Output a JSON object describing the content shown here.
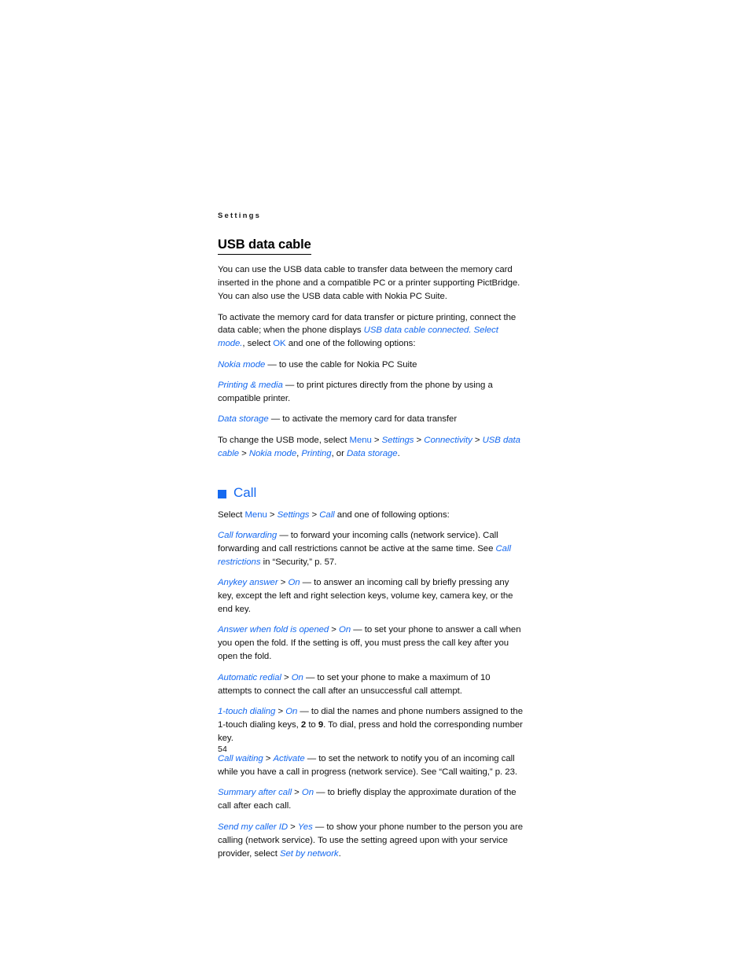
{
  "running_header": "Settings",
  "folio": "54",
  "colors": {
    "accent_blue": "#1569f0",
    "body_text": "#111111"
  },
  "sections": [
    {
      "id": "usb-data-cable",
      "heading": "USB data cable",
      "heading_style": "underlined",
      "paragraphs": [
        {
          "id": "usb-intro",
          "runs": [
            {
              "t": "You can use the USB data cable to transfer data between the memory card inserted in the phone and a compatible PC or a printer supporting PictBridge. You can also use the USB data cable with Nokia PC Suite.",
              "s": "plain"
            }
          ]
        },
        {
          "id": "usb-activate",
          "runs": [
            {
              "t": "To activate the memory card for data transfer or picture printing, connect the data cable; when the phone displays ",
              "s": "plain"
            },
            {
              "t": "USB data cable connected. Select mode.",
              "s": "ui"
            },
            {
              "t": ", select ",
              "s": "plain"
            },
            {
              "t": "OK",
              "s": "key"
            },
            {
              "t": " and one of the following options:",
              "s": "plain"
            }
          ]
        },
        {
          "id": "usb-opt-nokia-mode",
          "runs": [
            {
              "t": "Nokia mode",
              "s": "ui"
            },
            {
              "t": " — to use the cable for Nokia PC Suite",
              "s": "plain"
            }
          ]
        },
        {
          "id": "usb-opt-printing-media",
          "runs": [
            {
              "t": "Printing & media",
              "s": "ui"
            },
            {
              "t": " — to print pictures directly from the phone by using a compatible printer.",
              "s": "plain"
            }
          ]
        },
        {
          "id": "usb-opt-data-storage",
          "runs": [
            {
              "t": "Data storage",
              "s": "ui"
            },
            {
              "t": " — to activate the memory card for data transfer",
              "s": "plain"
            }
          ]
        },
        {
          "id": "usb-change-mode",
          "runs": [
            {
              "t": "To change the USB mode, select ",
              "s": "plain"
            },
            {
              "t": "Menu",
              "s": "key"
            },
            {
              "t": " > ",
              "s": "gt"
            },
            {
              "t": "Settings",
              "s": "ui"
            },
            {
              "t": " > ",
              "s": "gt"
            },
            {
              "t": "Connectivity",
              "s": "ui"
            },
            {
              "t": " > ",
              "s": "gt"
            },
            {
              "t": "USB data cable",
              "s": "ui"
            },
            {
              "t": " > ",
              "s": "gt"
            },
            {
              "t": "Nokia mode",
              "s": "ui"
            },
            {
              "t": ", ",
              "s": "plain"
            },
            {
              "t": "Printing",
              "s": "ui"
            },
            {
              "t": ", or ",
              "s": "plain"
            },
            {
              "t": "Data storage",
              "s": "ui"
            },
            {
              "t": ".",
              "s": "plain"
            }
          ]
        }
      ]
    },
    {
      "id": "call",
      "heading": "Call",
      "heading_style": "chapter",
      "bullet_icon": "blue-square-bullet",
      "paragraphs": [
        {
          "id": "call-intro",
          "runs": [
            {
              "t": "Select ",
              "s": "plain"
            },
            {
              "t": "Menu",
              "s": "key"
            },
            {
              "t": " > ",
              "s": "gt"
            },
            {
              "t": "Settings",
              "s": "ui"
            },
            {
              "t": " > ",
              "s": "gt"
            },
            {
              "t": "Call",
              "s": "ui"
            },
            {
              "t": " and one of following options:",
              "s": "plain"
            }
          ]
        },
        {
          "id": "call-forwarding",
          "runs": [
            {
              "t": "Call forwarding",
              "s": "ui"
            },
            {
              "t": " — to forward your incoming calls (network service). Call forwarding and call restrictions cannot be active at the same time. See ",
              "s": "plain"
            },
            {
              "t": "Call restrictions",
              "s": "ui"
            },
            {
              "t": " in “Security,” p. 57.",
              "s": "plain"
            }
          ]
        },
        {
          "id": "anykey-answer",
          "runs": [
            {
              "t": "Anykey answer",
              "s": "ui"
            },
            {
              "t": " > ",
              "s": "gt"
            },
            {
              "t": "On",
              "s": "ui"
            },
            {
              "t": " — to answer an incoming call by briefly pressing any key, except the left and right selection keys, volume key, camera key, or the end key.",
              "s": "plain"
            }
          ]
        },
        {
          "id": "answer-when-fold-is-opened",
          "runs": [
            {
              "t": "Answer when fold is opened",
              "s": "ui"
            },
            {
              "t": " > ",
              "s": "gt"
            },
            {
              "t": "On",
              "s": "ui"
            },
            {
              "t": " — to set your phone to answer a call when you open the fold. If the setting is off, you must press the call key after you open the fold.",
              "s": "plain"
            }
          ]
        },
        {
          "id": "automatic-redial",
          "runs": [
            {
              "t": "Automatic redial",
              "s": "ui"
            },
            {
              "t": " > ",
              "s": "gt"
            },
            {
              "t": "On",
              "s": "ui"
            },
            {
              "t": " — to set your phone to make a maximum of 10 attempts to connect the call after an unsuccessful call attempt.",
              "s": "plain"
            }
          ]
        },
        {
          "id": "one-touch-dialing",
          "runs": [
            {
              "t": "1-touch dialing",
              "s": "ui"
            },
            {
              "t": " > ",
              "s": "gt"
            },
            {
              "t": "On",
              "s": "ui"
            },
            {
              "t": " — to dial the names and phone numbers assigned to the 1-touch dialing keys, ",
              "s": "plain"
            },
            {
              "t": "2",
              "s": "bold"
            },
            {
              "t": " to ",
              "s": "plain"
            },
            {
              "t": "9",
              "s": "bold"
            },
            {
              "t": ". To dial, press and hold the corresponding number key.",
              "s": "plain"
            }
          ]
        },
        {
          "id": "call-waiting",
          "runs": [
            {
              "t": "Call waiting",
              "s": "ui"
            },
            {
              "t": " > ",
              "s": "gt"
            },
            {
              "t": "Activate",
              "s": "ui"
            },
            {
              "t": " — to set the network to notify you of an incoming call while you have a call in progress (network service). See “Call waiting,” p. 23.",
              "s": "plain"
            }
          ]
        },
        {
          "id": "summary-after-call",
          "runs": [
            {
              "t": "Summary after call",
              "s": "ui"
            },
            {
              "t": " > ",
              "s": "gt"
            },
            {
              "t": "On",
              "s": "ui"
            },
            {
              "t": " — to briefly display the approximate duration of the call after each call.",
              "s": "plain"
            }
          ]
        },
        {
          "id": "send-my-caller-id",
          "runs": [
            {
              "t": "Send my caller ID",
              "s": "ui"
            },
            {
              "t": " > ",
              "s": "gt"
            },
            {
              "t": "Yes",
              "s": "ui"
            },
            {
              "t": " — to show your phone number to the person you are calling (network service). To use the setting agreed upon with your service provider, select ",
              "s": "plain"
            },
            {
              "t": "Set by network",
              "s": "ui"
            },
            {
              "t": ".",
              "s": "plain"
            }
          ]
        }
      ]
    }
  ]
}
